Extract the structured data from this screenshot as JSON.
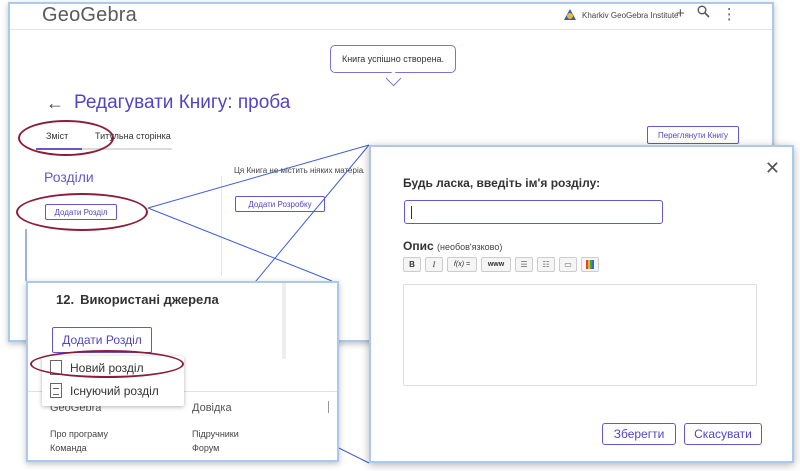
{
  "app": {
    "logo": "GeoGebra",
    "institute": "Kharkiv GeoGebra Institute",
    "icons": [
      "plus-icon",
      "search-icon",
      "more-vertical-icon"
    ],
    "toast": "Книга успішно створена.",
    "page_title": "Редагувати Книгу: проба",
    "tabs": [
      {
        "label": "Зміст",
        "active": true
      },
      {
        "label": "Титульна сторінка",
        "active": false
      }
    ],
    "view_book_label": "Переглянути Книгу",
    "sections_label": "Розділи",
    "add_section_label": "Додати Розділ",
    "empty_text": "Ця Книга не містить ніяких матеріалів",
    "add_material_label": "Додати Розробку"
  },
  "zoom": {
    "section_number": "12.",
    "section_title": "Використані джерела",
    "add_section_label": "Додати Розділ",
    "menu": [
      {
        "label": "Новий розділ",
        "icon": "document-icon"
      },
      {
        "label": "Існуючий розділ",
        "icon": "document-lines-icon"
      }
    ],
    "footer": {
      "col1_title": "GeoGebra",
      "col2_title": "Довідка",
      "col1_links": [
        "Про програму",
        "Команда"
      ],
      "col2_links": [
        "Підручники",
        "Форум"
      ]
    }
  },
  "dialog": {
    "name_label": "Будь ласка, введіть ім'я розділу:",
    "name_value": "",
    "desc_label": "Опис",
    "desc_optional": "(необов'язково)",
    "toolbar": [
      "B",
      "I",
      "f(x) =",
      "www"
    ],
    "save_label": "Зберегти",
    "cancel_label": "Скасувати"
  },
  "colors": {
    "accent": "#5145c4",
    "annotation": "#8b1d3a",
    "frame": "#a9c9ee"
  }
}
